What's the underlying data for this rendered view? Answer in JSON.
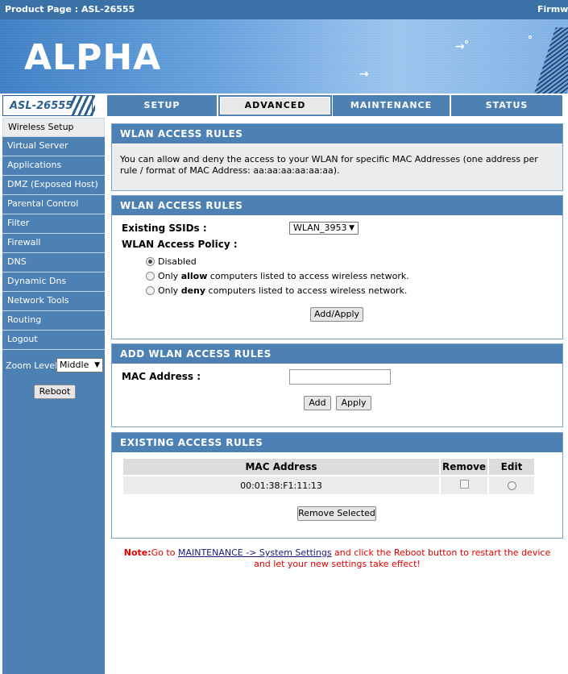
{
  "topbar": {
    "product_page": "Product Page : ASL-26555",
    "firmware": "Firmwa"
  },
  "banner": {
    "logo": "ALPHA"
  },
  "nav": {
    "model": "ASL-26555",
    "tabs": [
      "SETUP",
      "ADVANCED",
      "MAINTENANCE",
      "STATUS"
    ],
    "active_tab": "ADVANCED"
  },
  "sidebar": {
    "items": [
      "Wireless Setup",
      "Virtual Server",
      "Applications",
      "DMZ (Exposed Host)",
      "Parental Control",
      "Filter",
      "Firewall",
      "DNS",
      "Dynamic Dns",
      "Network Tools",
      "Routing",
      "Logout"
    ],
    "active_item": "Wireless Setup",
    "zoom_label": "Zoom Level:",
    "zoom_value": "Middle",
    "reboot_label": "Reboot"
  },
  "intro": {
    "title": "WLAN ACCESS RULES",
    "text": "You can allow and deny the access to your WLAN for specific MAC Addresses (one address per rule / format of MAC Address: aa:aa:aa:aa:aa:aa)."
  },
  "rules": {
    "title": "WLAN ACCESS RULES",
    "ssid_label": "Existing SSIDs :",
    "ssid_value": "WLAN_3953",
    "policy_label": "WLAN Access Policy :",
    "options": {
      "disabled": "Disabled",
      "allow_pre": "Only ",
      "allow_bold": "allow",
      "allow_post": " computers listed to access wireless network.",
      "deny_pre": "Only ",
      "deny_bold": "deny",
      "deny_post": " computers listed to access wireless network."
    },
    "selected_option": "Disabled",
    "apply_label": "Add/Apply"
  },
  "add": {
    "title": "ADD WLAN ACCESS RULES",
    "mac_label": "MAC Address :",
    "mac_value": "",
    "add_label": "Add",
    "apply_label": "Apply"
  },
  "existing": {
    "title": "EXISTING ACCESS RULES",
    "columns": [
      "MAC Address",
      "Remove",
      "Edit"
    ],
    "rows": [
      {
        "mac": "00:01:38:F1:11:13",
        "remove": false,
        "edit": false
      }
    ],
    "remove_selected_label": "Remove Selected"
  },
  "note": {
    "prefix": "Note:",
    "text1": "Go to ",
    "link": "MAINTENANCE -> System Settings",
    "text2": " and click the Reboot button to restart the device",
    "line2": "and let your new settings take effect!"
  },
  "colors": {
    "primary": "#4e81b3",
    "panel_border": "#7aa0c7",
    "note": "#e00000"
  }
}
